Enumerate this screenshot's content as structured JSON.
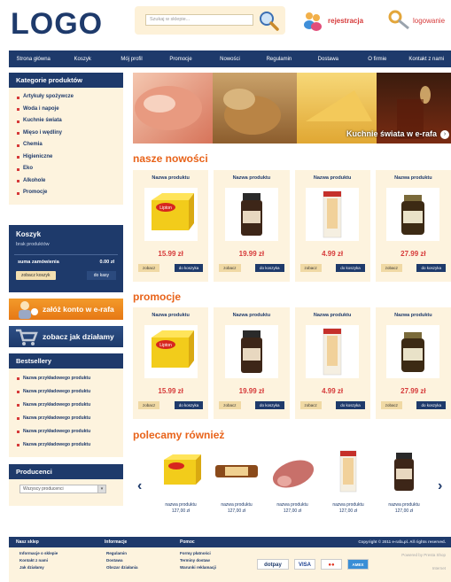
{
  "header": {
    "logo": "LOGO",
    "search_placeholder": "Szukaj w sklepie...",
    "register_label": "rejestracja",
    "login_label": "logowanie"
  },
  "nav": [
    "Strona główna",
    "Koszyk",
    "Mój profil",
    "Promocje",
    "Nowości",
    "Regulamin",
    "Dostawa",
    "O firmie",
    "Kontakt z nami"
  ],
  "categories": {
    "title": "Kategorie produktów",
    "items": [
      "Artykuły spożywcze",
      "Woda i napoje",
      "Kuchnie świata",
      "Mięso i wędliny",
      "Chemia",
      "Higieniczne",
      "Eko",
      "Alkohole",
      "Promocje"
    ]
  },
  "cart": {
    "title": "Koszyk",
    "empty": "brak produktów",
    "sum_label": "suma zamówienia",
    "sum_value": "0.00 zł",
    "show_btn": "zobacz koszyk",
    "checkout_btn": "do kasy"
  },
  "promo": {
    "create_account": "załóż konto w e-rafa",
    "how_we_work": "zobacz jak działamy"
  },
  "bestsellers": {
    "title": "Bestsellery",
    "items": [
      "Nazwa przykładowego produktu",
      "Nazwa przykładowego produktu",
      "Nazwa przykładowego produktu",
      "Nazwa przykładowego produktu",
      "Nazwa przykładowego produktu",
      "Nazwa przykładowego produktu"
    ]
  },
  "producers": {
    "title": "Producenci",
    "selected": "Wszyscy producenci"
  },
  "banner": {
    "caption": "Kuchnie świata w e-rafa"
  },
  "sections": {
    "new": "nasze nowości",
    "promo": "promocje",
    "recommended": "polecamy również"
  },
  "products_new": [
    {
      "name": "Nazwa produktu",
      "price": "15.99 zł"
    },
    {
      "name": "Nazwa produktu",
      "price": "19.99 zł"
    },
    {
      "name": "Nazwa produktu",
      "price": "4.99 zł"
    },
    {
      "name": "Nazwa produktu",
      "price": "27.99 zł"
    }
  ],
  "products_promo": [
    {
      "name": "Nazwa produktu",
      "price": "15.99 zł"
    },
    {
      "name": "Nazwa produktu",
      "price": "19.99 zł"
    },
    {
      "name": "Nazwa produktu",
      "price": "4.99 zł"
    },
    {
      "name": "Nazwa produktu",
      "price": "27.99 zł"
    }
  ],
  "card_buttons": {
    "view": "zobacz",
    "add": "do koszyka"
  },
  "recommended": [
    {
      "name": "nazwa produktu",
      "price": "127,00 zł"
    },
    {
      "name": "nazwa produktu",
      "price": "127,00 zł"
    },
    {
      "name": "nazwa produktu",
      "price": "127,00 zł"
    },
    {
      "name": "nazwa produktu",
      "price": "127,00 zł"
    },
    {
      "name": "nazwa produktu",
      "price": "127,00 zł"
    }
  ],
  "footer": {
    "col1_title": "Nasz sklep",
    "col2_title": "Informacje",
    "col3_title": "Pomoc",
    "copyright": "Copyright © 2011 e-rafa.pl. All rights reserved.",
    "col1": [
      "Informacje o sklepie",
      "Kontakt z nami",
      "Jak działamy"
    ],
    "col2": [
      "Regulamin",
      "Dostawa",
      "Obszar działania"
    ],
    "col3": [
      "Formy płatności",
      "Terminy dostaw",
      "Warunki reklamacji"
    ],
    "payments": [
      "dotpay",
      "VISA",
      "●●",
      "AMEX"
    ],
    "powered": "Powered by Presta Shop",
    "badge": "Internet"
  },
  "colors": {
    "navy": "#1e3a6b",
    "orange": "#e8631a",
    "red": "#d63a3a",
    "cream": "#fdf3de"
  }
}
